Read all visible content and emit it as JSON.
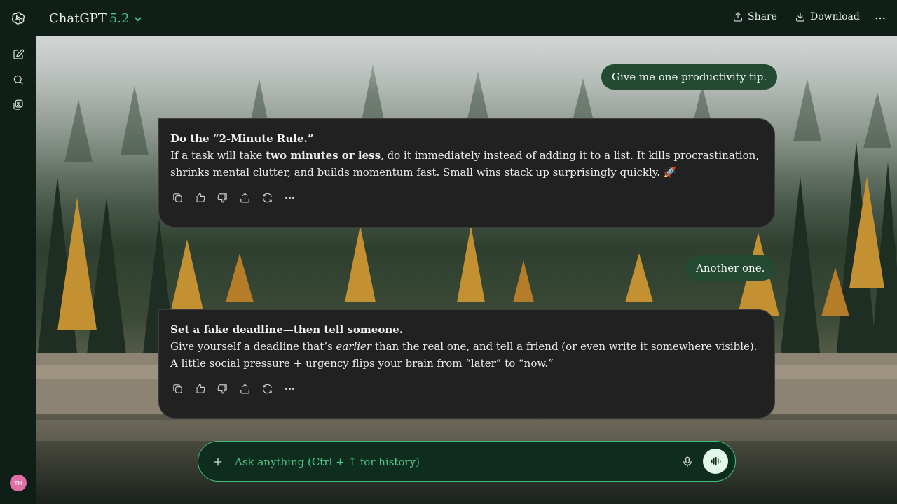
{
  "app": {
    "model_name": "ChatGPT",
    "model_version": "5.2"
  },
  "header": {
    "share_label": "Share",
    "download_label": "Download"
  },
  "sidebar": {
    "items": [
      {
        "icon": "new-chat-icon"
      },
      {
        "icon": "search-icon"
      },
      {
        "icon": "library-icon"
      }
    ],
    "avatar_initials": "TH"
  },
  "conversation": [
    {
      "role": "user",
      "text": "Give me one productivity tip."
    },
    {
      "role": "assistant",
      "title": "Do the “2-Minute Rule.”",
      "body_pre": "If a task will take ",
      "body_bold": "two minutes or less",
      "body_post": ", do it immediately instead of adding it to a list. It kills procrastination, shrinks mental clutter, and builds momentum fast. Small wins stack up surprisingly quickly. 🚀"
    },
    {
      "role": "user",
      "text": "Another one."
    },
    {
      "role": "assistant",
      "title": "Set a fake deadline—then tell someone.",
      "body_pre": "Give yourself a deadline that’s ",
      "body_italic": "earlier",
      "body_post": " than the real one, and tell a friend (or even write it somewhere visible). A little social pressure + urgency flips your brain from “later” to “now.”"
    }
  ],
  "composer": {
    "placeholder": "Ask anything (Ctrl + ↑ for history)"
  },
  "colors": {
    "accent": "#4ec98a",
    "user_bubble": "#244a34",
    "assistant_bubble": "#212121",
    "sidebar_bg": "#0f1f18",
    "avatar": "#e06fa6"
  }
}
